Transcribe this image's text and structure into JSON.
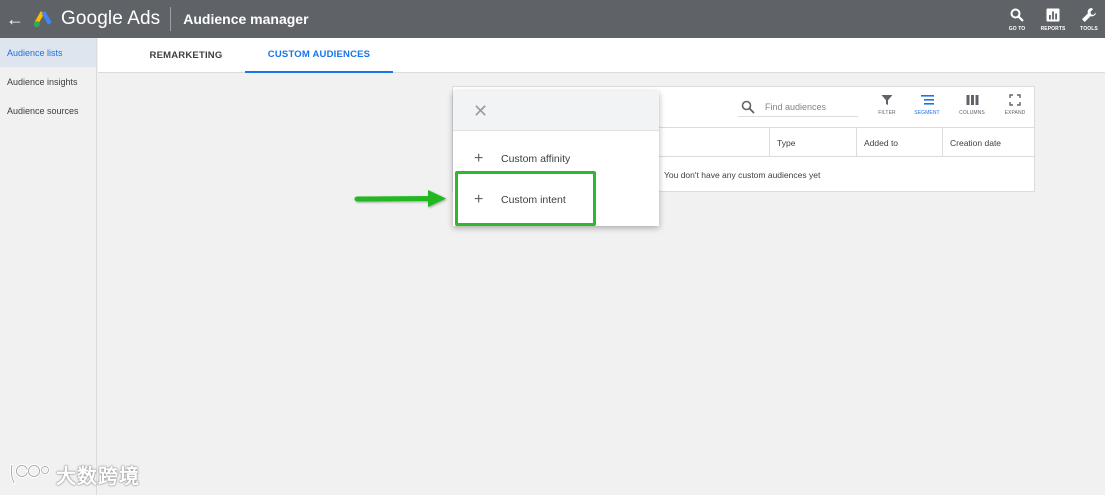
{
  "topbar": {
    "brand": "Google Ads",
    "page_title": "Audience manager",
    "actions": [
      {
        "label": "GO TO",
        "icon": "search-icon"
      },
      {
        "label": "REPORTS",
        "icon": "reports-icon"
      },
      {
        "label": "TOOLS",
        "icon": "wrench-icon"
      }
    ]
  },
  "sidebar": {
    "items": [
      {
        "label": "Audience lists",
        "active": true
      },
      {
        "label": "Audience insights",
        "active": false
      },
      {
        "label": "Audience sources",
        "active": false
      }
    ]
  },
  "tabs": [
    {
      "label": "REMARKETING",
      "active": false
    },
    {
      "label": "CUSTOM AUDIENCES",
      "active": true
    }
  ],
  "table": {
    "search_placeholder": "Find audiences",
    "tools": {
      "filter": "FILTER",
      "segment": "SEGMENT",
      "columns": "COLUMNS",
      "expand": "EXPAND"
    },
    "columns": [
      "Type",
      "Added to",
      "Creation date"
    ],
    "empty_message": "You don't have any custom audiences yet"
  },
  "menu": {
    "items": [
      {
        "label": "Custom affinity"
      },
      {
        "label": "Custom intent"
      }
    ]
  },
  "watermark": {
    "text": "大数跨境"
  },
  "colors": {
    "topbar": "#5f6368",
    "accent": "#1a73e8",
    "highlight": "#2db82d"
  }
}
